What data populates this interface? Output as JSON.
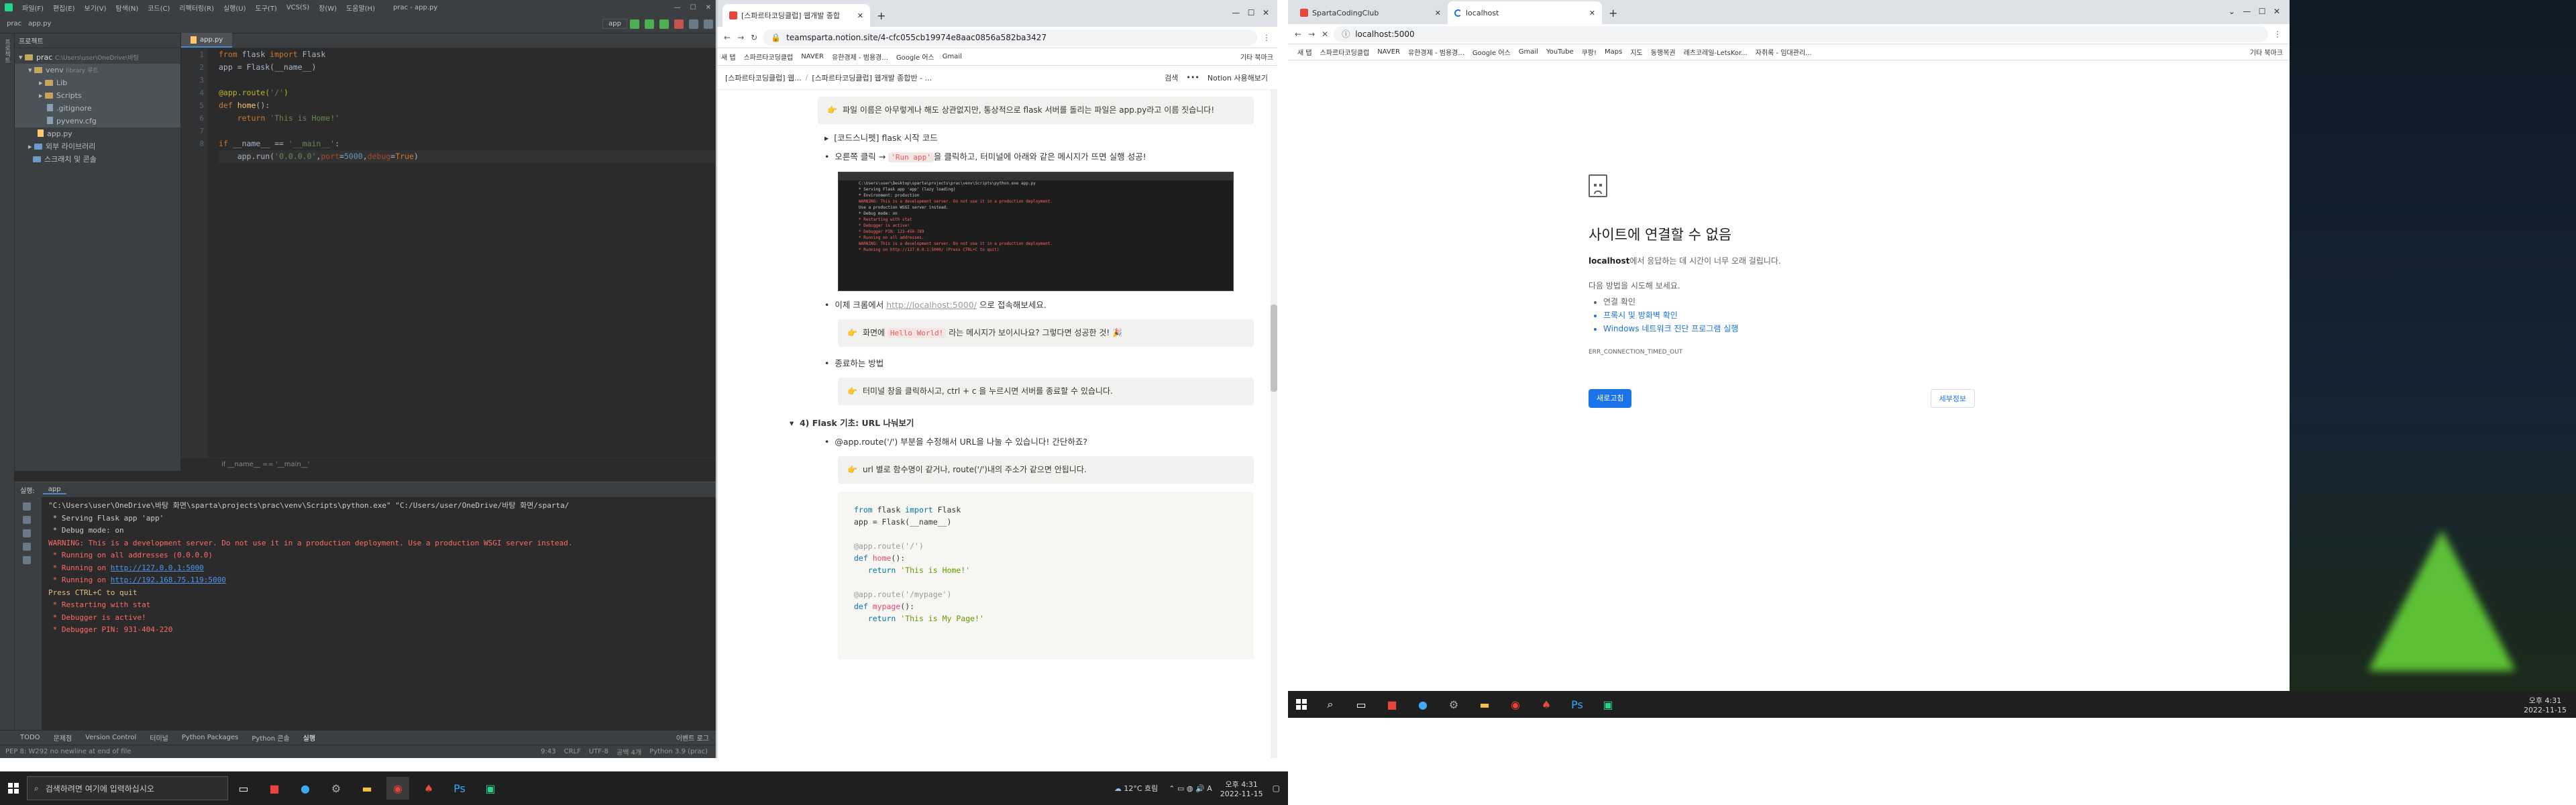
{
  "ide": {
    "menu": [
      "파일(F)",
      "편집(E)",
      "보기(V)",
      "탐색(N)",
      "코드(C)",
      "리팩터링(R)",
      "실행(U)",
      "도구(T)",
      "VCS(S)",
      "창(W)",
      "도움말(H)"
    ],
    "window_title": "prac - app.py",
    "run_config": "app",
    "breadcrumb": [
      "prac",
      "app.py"
    ],
    "project_label": "프로젝트",
    "tree": [
      {
        "label": "prac",
        "path": "C:\\Users\\user\\OneDrive\\바탕 ",
        "depth": 0,
        "type": "folder"
      },
      {
        "label": "venv",
        "path": "library 루트",
        "depth": 1,
        "type": "folder"
      },
      {
        "label": "Lib",
        "depth": 2,
        "type": "folder"
      },
      {
        "label": "Scripts",
        "depth": 2,
        "type": "folder"
      },
      {
        "label": ".gitignore",
        "depth": 2,
        "type": "file"
      },
      {
        "label": "pyvenv.cfg",
        "depth": 2,
        "type": "file"
      },
      {
        "label": "app.py",
        "depth": 1,
        "type": "file"
      },
      {
        "label": "외부 라이브러리",
        "depth": 0,
        "type": "folder"
      },
      {
        "label": "스크래치 및 콘솔",
        "depth": 0,
        "type": "folder"
      }
    ],
    "tab": "app.py",
    "line_numbers": [
      "1",
      "2",
      "3",
      "4",
      "5",
      "6",
      "7",
      "8"
    ],
    "code_breadcrumb": "if __name__ == '__main__'",
    "run_label": "실행:",
    "run_tab": "app",
    "console": [
      {
        "text": "\"C:\\Users\\user\\OneDrive\\바탕 화면\\sparta\\projects\\prac\\venv\\Scripts\\python.exe\" \"C:/Users/user/OneDrive/바탕 화면/sparta/",
        "c": "w"
      },
      {
        "text": " * Serving Flask app 'app'",
        "c": "w"
      },
      {
        "text": " * Debug mode: on",
        "c": "w"
      },
      {
        "text": "WARNING: This is a development server. Do not use it in a production deployment. Use a production WSGI server instead.",
        "c": "r"
      },
      {
        "text": " * Running on all addresses (0.0.0.0)",
        "c": "r"
      },
      {
        "text": " * Running on ",
        "c": "r",
        "link": "http://127.0.0.1:5000"
      },
      {
        "text": " * Running on ",
        "c": "r",
        "link": "http://192.168.75.119:5000"
      },
      {
        "text": "Press CTRL+C to quit",
        "c": "a"
      },
      {
        "text": " * Restarting with stat",
        "c": "r"
      },
      {
        "text": " * Debugger is active!",
        "c": "r"
      },
      {
        "text": " * Debugger PIN: 931-404-220",
        "c": "r"
      }
    ],
    "bottom_tabs": [
      "TODO",
      "문제점",
      "Version Control",
      "터미널",
      "Python Packages",
      "Python 콘솔",
      "실행"
    ],
    "event_log": "이벤트 로그",
    "status_left": "PEP 8: W292 no newline at end of file",
    "status_right": [
      "9:43",
      "CRLF",
      "UTF-8",
      "공백 4개",
      "Python 3.9 (prac)"
    ]
  },
  "notion": {
    "tabs": [
      "[스파르타코딩클럽] 웹개발 종합",
      "+"
    ],
    "url": "teamsparta.notion.site/4-cfc055cb19974e8aac0856a582ba3427",
    "bookmarks": [
      "새 탭",
      "스파르타코딩클럽",
      "NAVER",
      "유한경제 - 범용경...",
      "Google 어스",
      "Gmail",
      "기타 북마크"
    ],
    "breadcrumb": [
      "[스파르타코딩클럽] 웹...",
      "[스파르타코딩클럽] 웹개발 종합반 - ..."
    ],
    "search": "검색",
    "sign_up": "Notion 사용해보기",
    "callout1": "파일 이름은 아무렇게나 해도 상관없지만, 통상적으로 flask 서버를 돌리는 파일은 app.py라고 이름 짓습니다!",
    "toggle1": "[코드스니펫] flask 시작 코드",
    "run_text_pre": "오른쪽 클릭 → ",
    "run_code": "'Run app'",
    "run_text_post": "을 클릭하고, 터미널에 아래와 같은 메시지가 뜨면 실행 성공!",
    "visit_pre": "이제 크롬에서 ",
    "visit_link": "http://localhost:5000/",
    "visit_post": " 으로 접속해보세요.",
    "callout2_pre": "화면에 ",
    "callout2_code": "Hello World!",
    "callout2_post": " 라는 메시지가 보이시나요? 그렇다면 성공한 것!",
    "stop_title": "종료하는 방법",
    "callout3": "터미널 창을 클릭하시고, ctrl + c 을 누르시면 서버를 종료할 수 있습니다.",
    "section": "4) Flask 기초: URL 나눠보기",
    "route_text": "@app.route('/') 부분을 수정해서 URL을 나눌 수 있습니다! 간단하죠?",
    "callout4": "url 별로 함수명이 같거나, route('/')내의 주소가 같으면 안됩니다.",
    "code": [
      "from flask import Flask",
      "app = Flask(__name__)",
      "",
      "@app.route('/')",
      "def home():",
      "    return 'This is Home!'",
      "",
      "@app.route('/mypage')",
      "def mypage():",
      "    return 'This is My Page!'"
    ]
  },
  "localhost": {
    "tabs": [
      "SpartaCodingClub",
      "localhost",
      "+"
    ],
    "url": "localhost:5000",
    "bookmarks": [
      "새 탭",
      "스파르타코딩클럽",
      "NAVER",
      "유한경제 - 범용경...",
      "Google 어스",
      "Gmail",
      "YouTube",
      "쿠팡!",
      "Maps",
      "지도",
      "동행복권",
      "레츠코레일-LetsKor...",
      "자취록 - 임대관리...",
      "기타 북마크"
    ],
    "error_title": "사이트에 연결할 수 없음",
    "error_host": "localhost",
    "error_desc": "에서 응답하는 데 시간이 너무 오래 걸립니다.",
    "try_title": "다음 방법을 시도해 보세요.",
    "try_items": [
      "연결 확인",
      "프록시 및 방화벽 확인",
      "Windows 네트워크 진단 프로그램 실행"
    ],
    "error_code": "ERR_CONNECTION_TIMED_OUT",
    "reload": "새로고침",
    "details": "세부정보"
  },
  "taskbar": {
    "search_placeholder": "검색하려면 여기에 입력하십시오",
    "weather": "12°C 흐림",
    "time": "오후 4:31",
    "date": "2022-11-15",
    "time2": "오후 4:31",
    "date2": "2022-11-15"
  }
}
